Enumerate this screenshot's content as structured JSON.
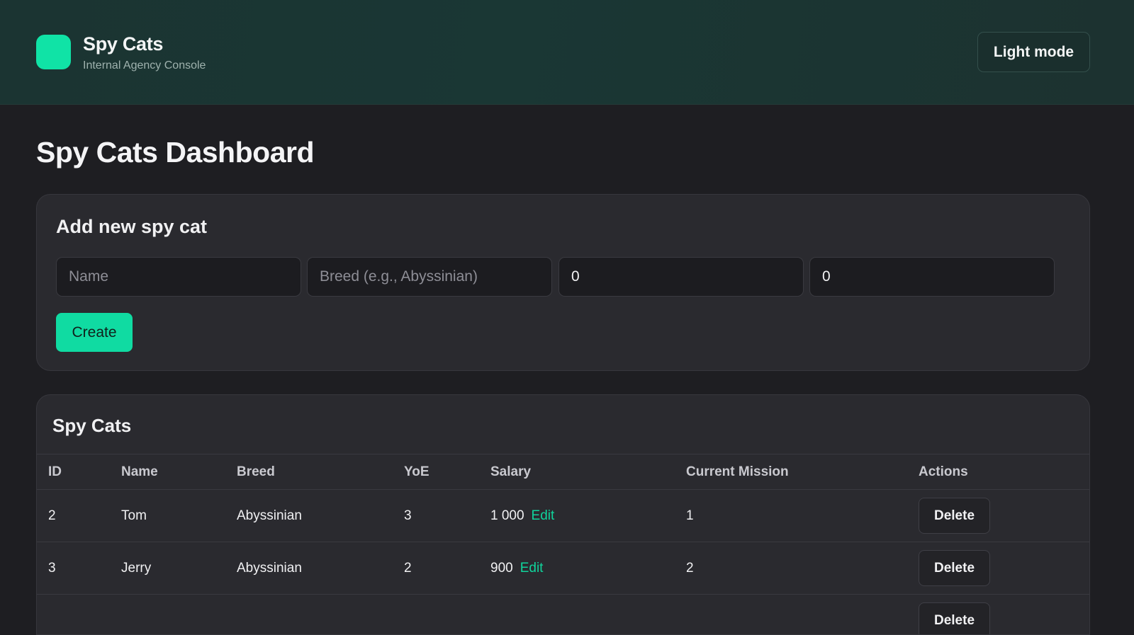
{
  "header": {
    "brand_name": "Spy Cats",
    "brand_subtitle": "Internal Agency Console",
    "theme_toggle_label": "Light mode"
  },
  "page": {
    "title": "Spy Cats Dashboard"
  },
  "create_form": {
    "title": "Add new spy cat",
    "name_placeholder": "Name",
    "breed_placeholder": "Breed (e.g., Abyssinian)",
    "years_value": "0",
    "salary_value": "0",
    "submit_label": "Create"
  },
  "table": {
    "title": "Spy Cats",
    "columns": [
      "ID",
      "Name",
      "Breed",
      "YoE",
      "Salary",
      "Current Mission",
      "Actions"
    ],
    "edit_label": "Edit",
    "delete_label": "Delete",
    "rows": [
      {
        "id": "2",
        "name": "Tom",
        "breed": "Abyssinian",
        "yoe": "3",
        "salary": "1 000",
        "mission": "1"
      },
      {
        "id": "3",
        "name": "Jerry",
        "breed": "Abyssinian",
        "yoe": "2",
        "salary": "900",
        "mission": "2"
      }
    ]
  },
  "colors": {
    "accent": "#10e3a6",
    "header_bg": "#1b3432",
    "page_bg": "#1e1e22",
    "card_bg": "#2a2a2f"
  }
}
